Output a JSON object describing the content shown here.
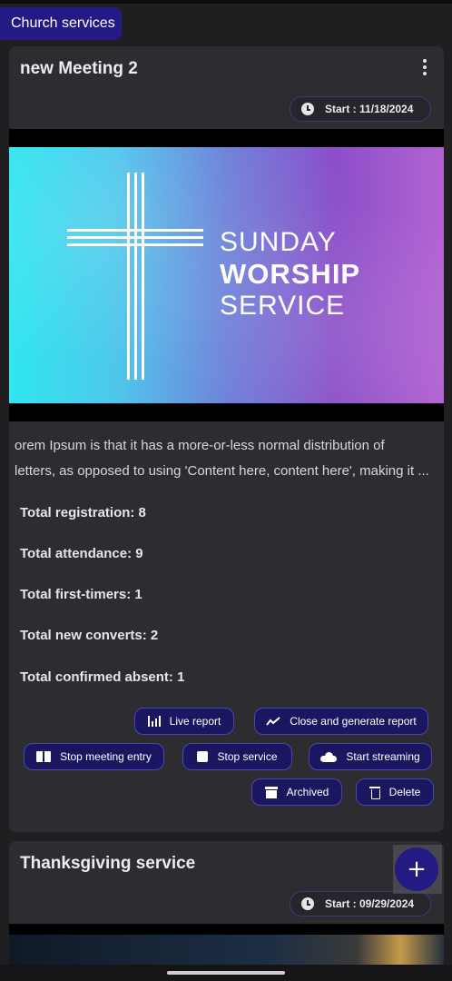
{
  "header": {
    "title": "Church services"
  },
  "meetings": [
    {
      "title": "new Meeting 2",
      "start": "Start : 11/18/2024",
      "banner": {
        "line1": "SUNDAY",
        "line2": "WORSHIP",
        "line3": "SERVICE"
      },
      "description_line1": "orem Ipsum is that it has a more-or-less normal distribution of",
      "description_line2": "letters, as opposed to using 'Content here, content here', making it ...",
      "stats": {
        "registration": "Total registration: 8",
        "attendance": "Total attendance: 9",
        "first_timers": "Total first-timers: 1",
        "new_converts": "Total new converts: 2",
        "confirmed_absent": "Total confirmed absent: 1"
      },
      "buttons": {
        "live_report": "Live report",
        "close_generate": "Close and generate report",
        "stop_entry": "Stop meeting entry",
        "stop_service": "Stop service",
        "start_streaming": "Start streaming",
        "archived": "Archived",
        "delete": "Delete"
      }
    },
    {
      "title": "Thanksgiving service",
      "start": "Start : 09/29/2024"
    }
  ],
  "fab": {
    "label": "+"
  },
  "colors": {
    "accent": "#231a84",
    "card": "#2d2d31",
    "background": "#1f1f22"
  }
}
